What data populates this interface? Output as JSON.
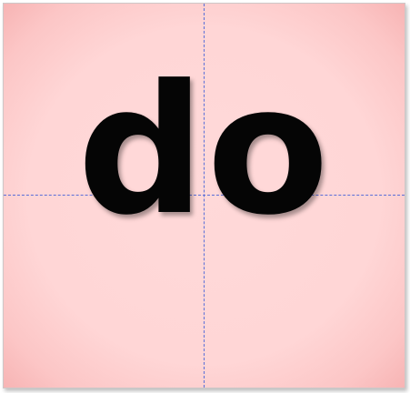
{
  "card": {
    "word": "do",
    "background_color": "#ffd6d6",
    "guide_line_color": "#5a6ed8",
    "text_color": "#050505"
  }
}
